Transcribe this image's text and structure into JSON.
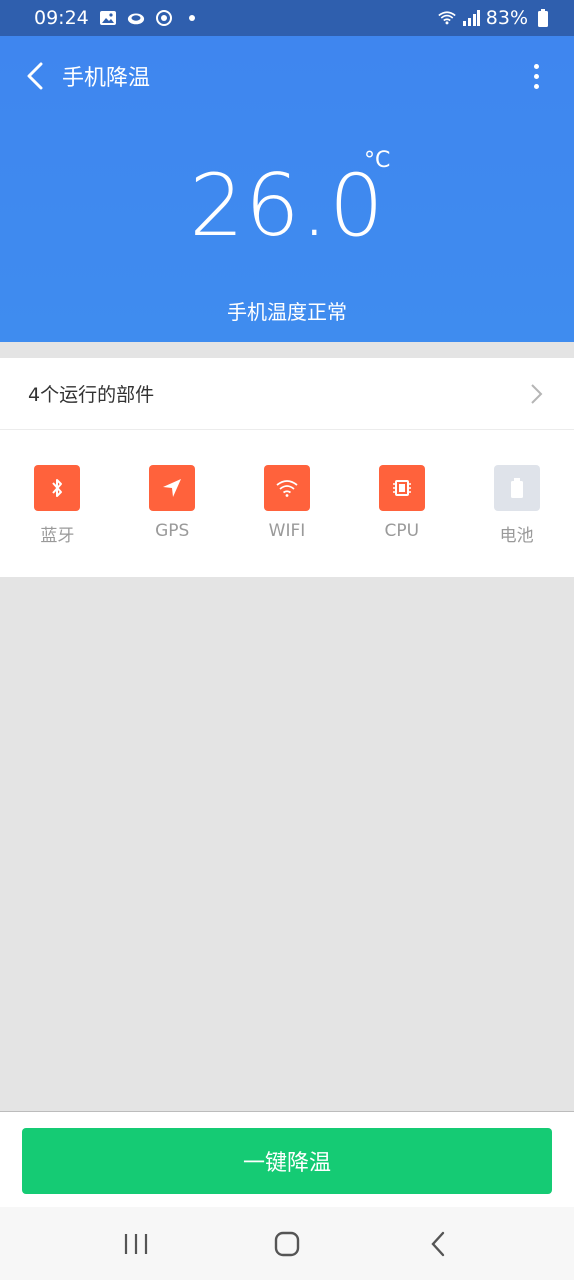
{
  "status_bar": {
    "time": "09:24",
    "battery": "83%"
  },
  "header": {
    "title": "手机降温",
    "temperature": "26.0",
    "unit": "°C",
    "status": "手机温度正常"
  },
  "components": {
    "summary": "4个运行的部件",
    "items": [
      {
        "label": "蓝牙",
        "icon": "bluetooth-icon",
        "active": true
      },
      {
        "label": "GPS",
        "icon": "location-arrow-icon",
        "active": true
      },
      {
        "label": "WIFI",
        "icon": "wifi-icon",
        "active": true
      },
      {
        "label": "CPU",
        "icon": "cpu-chip-icon",
        "active": true
      },
      {
        "label": "电池",
        "icon": "battery-icon",
        "active": false
      }
    ]
  },
  "action": {
    "cool_button": "一键降温"
  },
  "colors": {
    "header_bg": "#3f8cef",
    "accent_active": "#ff623c",
    "button_green": "#15cb74"
  }
}
